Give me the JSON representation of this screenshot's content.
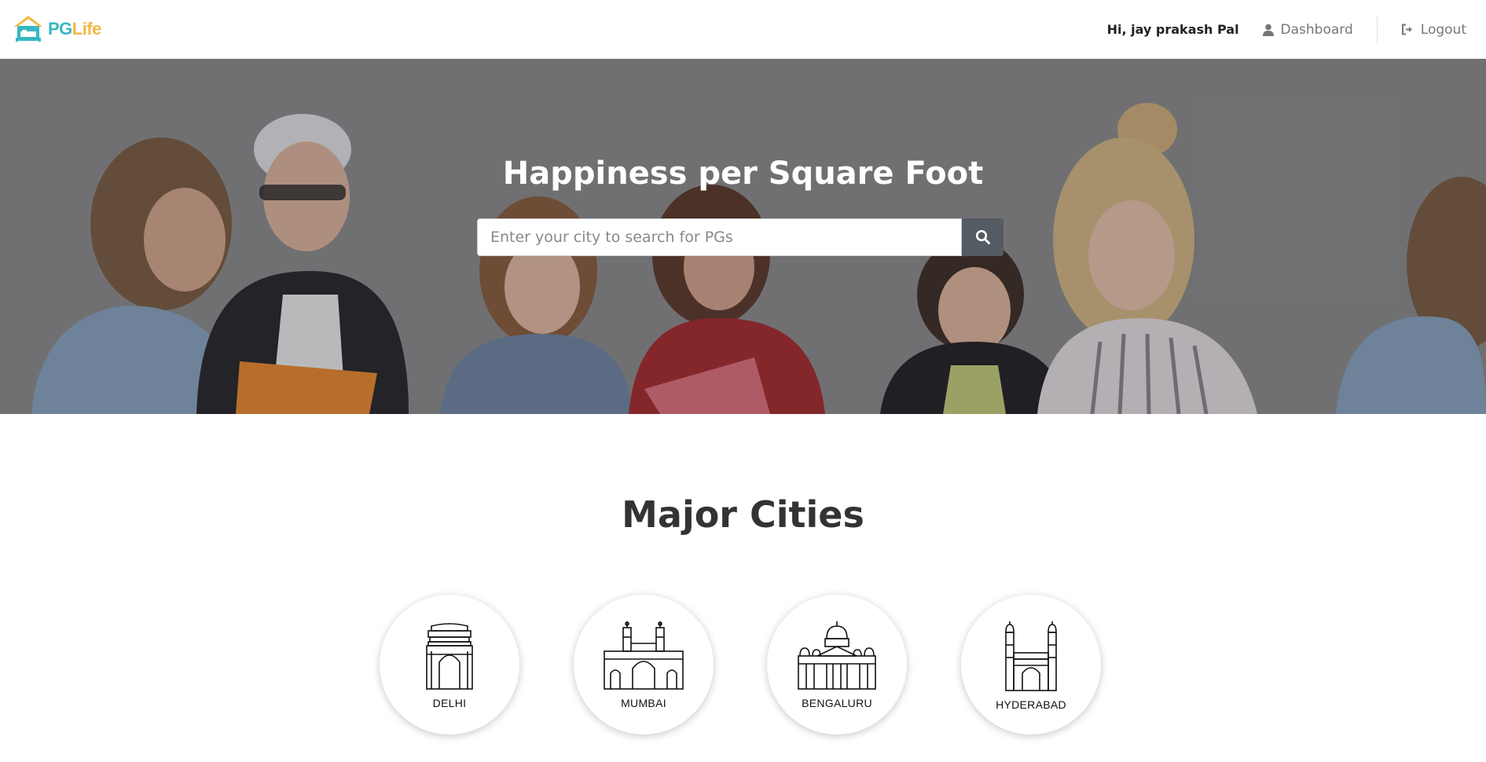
{
  "header": {
    "logo": {
      "part1": "PG",
      "part2": "Life"
    },
    "greeting": "Hi, jay prakash Pal",
    "dashboard_label": "Dashboard",
    "logout_label": "Logout"
  },
  "banner": {
    "title": "Happiness per Square Foot",
    "search": {
      "placeholder": "Enter your city to search for PGs",
      "value": ""
    }
  },
  "cities_section": {
    "title": "Major Cities",
    "cities": [
      {
        "name": "DELHI",
        "icon": "india-gate-icon"
      },
      {
        "name": "MUMBAI",
        "icon": "gateway-of-india-icon"
      },
      {
        "name": "BENGALURU",
        "icon": "vidhana-soudha-icon"
      },
      {
        "name": "HYDERABAD",
        "icon": "charminar-icon"
      }
    ]
  },
  "colors": {
    "logo_teal": "#37b7c3",
    "logo_yellow": "#f3b740",
    "search_button": "#545b62"
  }
}
